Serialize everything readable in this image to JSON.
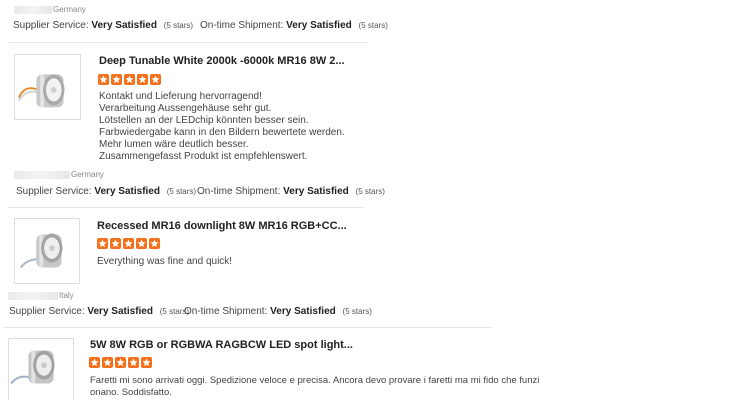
{
  "reviews": [
    {
      "country": "Germany",
      "supplier_label": "Supplier Service:",
      "supplier_value": "Very Satisfied",
      "supplier_stars": "(5 stars)",
      "shipment_label": "On-time Shipment:",
      "shipment_value": "Very Satisfied",
      "shipment_stars": "(5 stars)"
    },
    {
      "title": "Deep Tunable White 2000k -6000k MR16 8W 2...",
      "rating": 5,
      "text_lines": [
        "Kontakt und Lieferung hervorragend!",
        "Verarbeitung Aussengehäuse sehr gut.",
        "Lötstellen an der LEDchip könnten besser sein.",
        "Farbwiedergabe kann in den Bildern bewertete werden.",
        "Mehr lumen wäre deutlich besser.",
        "Zusammengefasst Produkt ist empfehlenswert."
      ],
      "country": "Germany",
      "supplier_label": "Supplier Service:",
      "supplier_value": "Very Satisfied",
      "supplier_stars": "(5 stars)",
      "shipment_label": "On-time Shipment:",
      "shipment_value": "Very Satisfied",
      "shipment_stars": "(5 stars)"
    },
    {
      "title": "Recessed MR16 downlight 8W MR16 RGB+CC...",
      "rating": 5,
      "text_lines": [
        "Everything was fine and quick!"
      ],
      "country": "Italy",
      "supplier_label": "Supplier Service:",
      "supplier_value": "Very Satisfied",
      "supplier_stars": "(5 stars)",
      "shipment_label": "On-time Shipment:",
      "shipment_value": "Very Satisfied",
      "shipment_stars": "(5 stars)"
    },
    {
      "title": "5W 8W RGB or RGBWA RAGBCW LED spot light...",
      "rating": 5,
      "text_lines": [
        "Faretti mi sono arrivati oggi. Spedizione veloce e precisa. Ancora devo provare i faretti ma mi fido che funzi",
        "onano. Soddisfatto."
      ]
    }
  ],
  "colors": {
    "star": "#f3711d",
    "divider": "#e6e6e6"
  },
  "icons": {
    "star": "star-icon",
    "product": "mr16-led-spotlight-image"
  }
}
